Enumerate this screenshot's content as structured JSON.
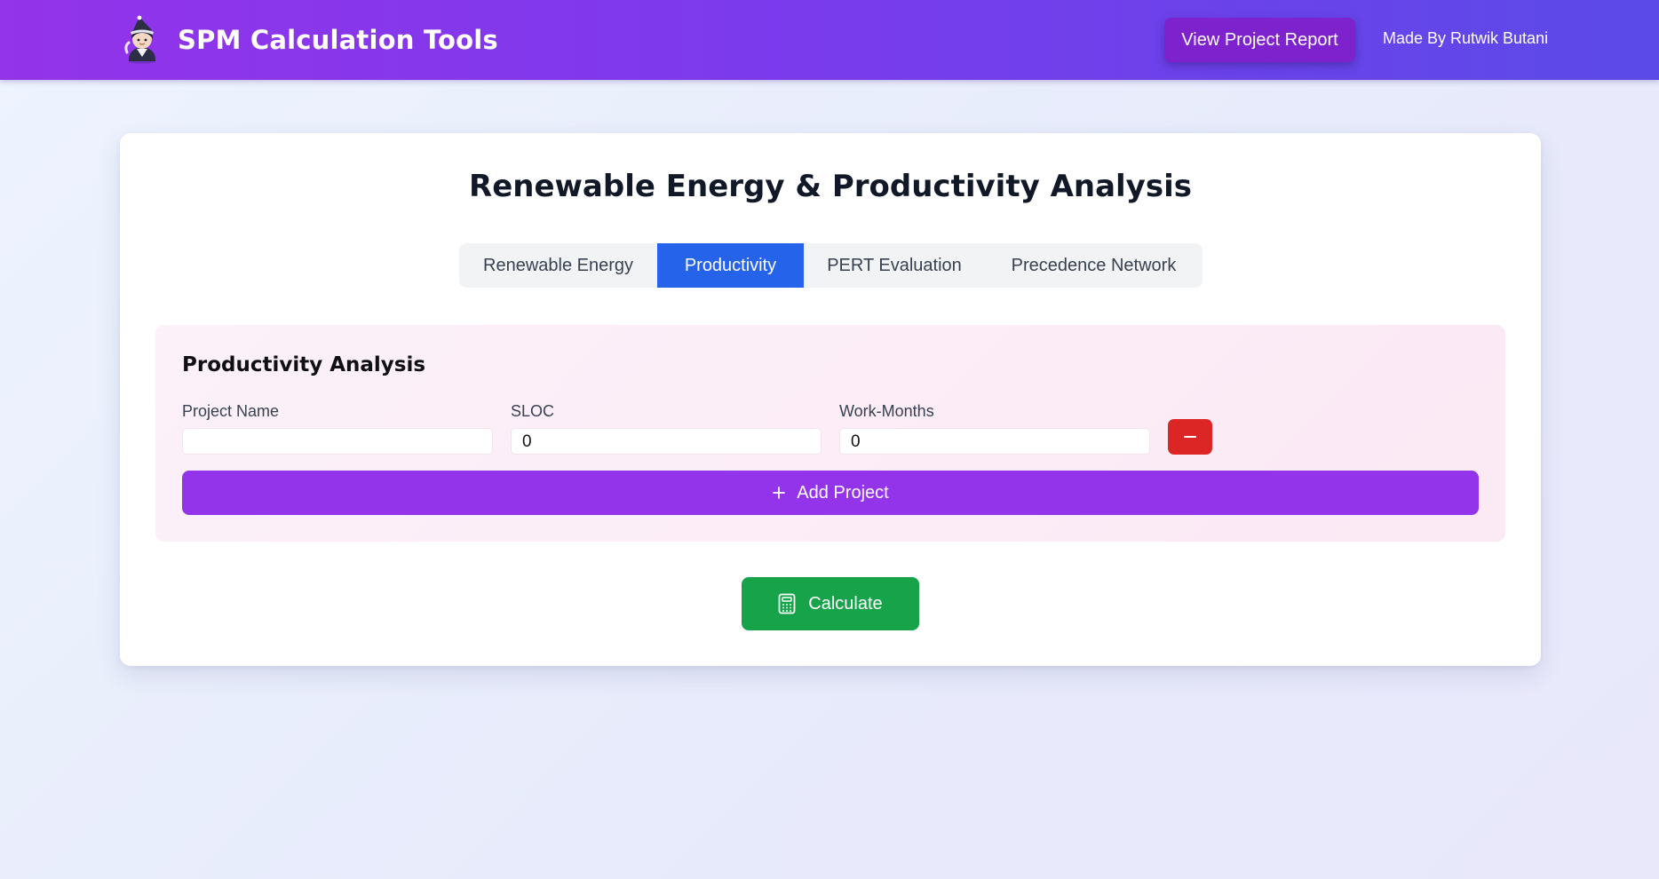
{
  "header": {
    "title": "SPM Calculation Tools",
    "logo_icon": "wizard-avatar-icon",
    "report_button_label": "View Project Report",
    "made_by": "Made By Rutwik Butani"
  },
  "main": {
    "title": "Renewable Energy & Productivity Analysis",
    "tabs": [
      {
        "label": "Renewable Energy",
        "active": false
      },
      {
        "label": "Productivity",
        "active": true
      },
      {
        "label": "PERT Evaluation",
        "active": false
      },
      {
        "label": "Precedence Network",
        "active": false
      }
    ]
  },
  "productivity": {
    "heading": "Productivity Analysis",
    "fields": [
      {
        "label": "Project Name",
        "value": ""
      },
      {
        "label": "SLOC",
        "value": "0"
      },
      {
        "label": "Work-Months",
        "value": "0"
      }
    ],
    "remove_icon": "minus-icon",
    "add_icon": "plus-icon",
    "add_button_label": "Add Project"
  },
  "calculate": {
    "icon": "calculator-icon",
    "label": "Calculate"
  },
  "colors": {
    "header_start": "#9333ea",
    "header_end": "#5b4ae8",
    "report_button": "#7e22ce",
    "active_tab": "#2563eb",
    "add_button": "#9333ea",
    "remove_button": "#dc2626",
    "calculate_button": "#16a34a"
  }
}
